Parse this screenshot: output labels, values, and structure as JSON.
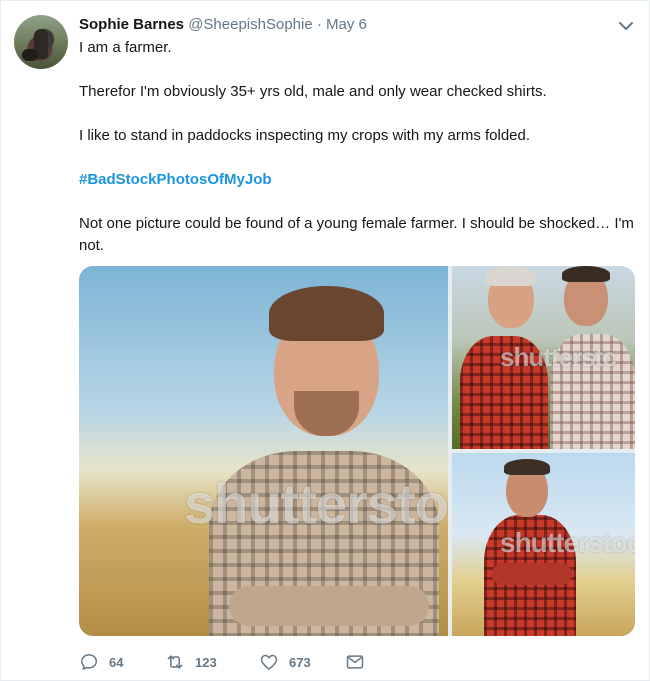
{
  "tweet": {
    "author_name": "Sophie Barnes",
    "handle": "@SheepishSophie",
    "separator": "·",
    "date": "May 6",
    "paragraphs": [
      "I am a farmer.",
      "Therefor I'm obviously 35+ yrs old, male and only wear checked shirts.",
      "I like to stand in paddocks inspecting my crops with my arms folded.",
      "#BadStockPhotosOfMyJob",
      "Not one picture could be found of a young female farmer. I should be shocked… I'm not."
    ],
    "hashtag_color": "#1b95e0"
  },
  "media": {
    "watermark": "shutterstock",
    "images": [
      {
        "name": "farmer-smiling-arms-folded-photo",
        "watermark": "shutterstoc"
      },
      {
        "name": "two-farmers-inspecting-crops-photo",
        "watermark": "shutterstc"
      },
      {
        "name": "farmer-in-red-plaid-field-photo",
        "watermark": "shutterstoc"
      }
    ]
  },
  "actions": {
    "replies": "64",
    "retweets": "123",
    "likes": "673",
    "icons": [
      "reply-icon",
      "retweet-icon",
      "like-icon",
      "direct-message-icon"
    ]
  },
  "colors": {
    "text": "#14171a",
    "muted": "#657786",
    "link": "#1b95e0",
    "border": "#e6ecf0"
  }
}
